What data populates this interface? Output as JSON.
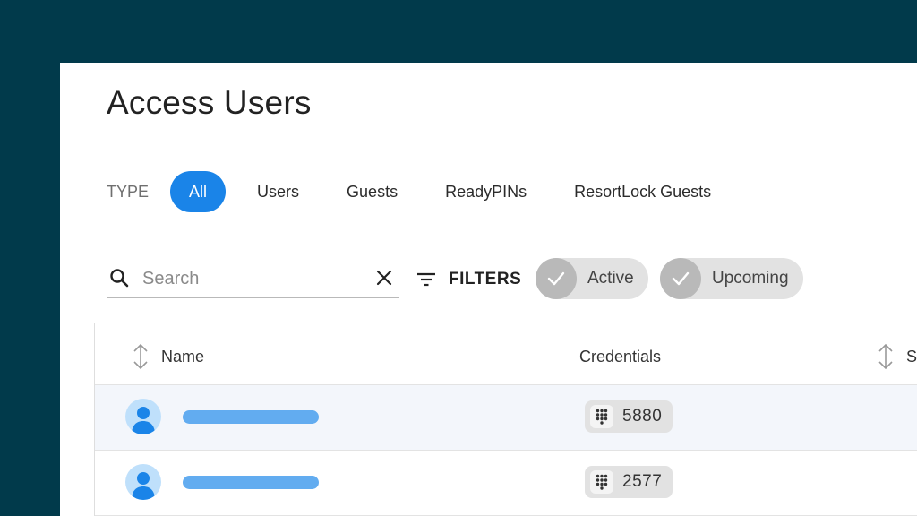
{
  "page": {
    "title": "Access Users"
  },
  "type_filter": {
    "label": "TYPE",
    "tabs": [
      {
        "label": "All",
        "active": true
      },
      {
        "label": "Users",
        "active": false
      },
      {
        "label": "Guests",
        "active": false
      },
      {
        "label": "ReadyPINs",
        "active": false
      },
      {
        "label": "ResortLock Guests",
        "active": false
      }
    ]
  },
  "search": {
    "placeholder": "Search",
    "value": ""
  },
  "filters": {
    "label": "FILTERS",
    "chips": [
      {
        "label": "Active",
        "checked": true
      },
      {
        "label": "Upcoming",
        "checked": true
      }
    ]
  },
  "table": {
    "columns": {
      "name": "Name",
      "credentials": "Credentials",
      "status": "S"
    },
    "rows": [
      {
        "credential": "5880"
      },
      {
        "credential": "2577"
      }
    ]
  },
  "colors": {
    "background": "#013a4b",
    "accent": "#1a84e8",
    "name_placeholder": "#62acf0",
    "avatar_bg": "#bfe0fb",
    "avatar_fg": "#1a84e8"
  },
  "icons": {
    "search": "search-icon",
    "clear": "close-icon",
    "filters": "filter-icon",
    "chip_check": "check-icon",
    "sort": "sort-icon",
    "avatar": "user-avatar-icon",
    "credential": "keypad-icon"
  }
}
